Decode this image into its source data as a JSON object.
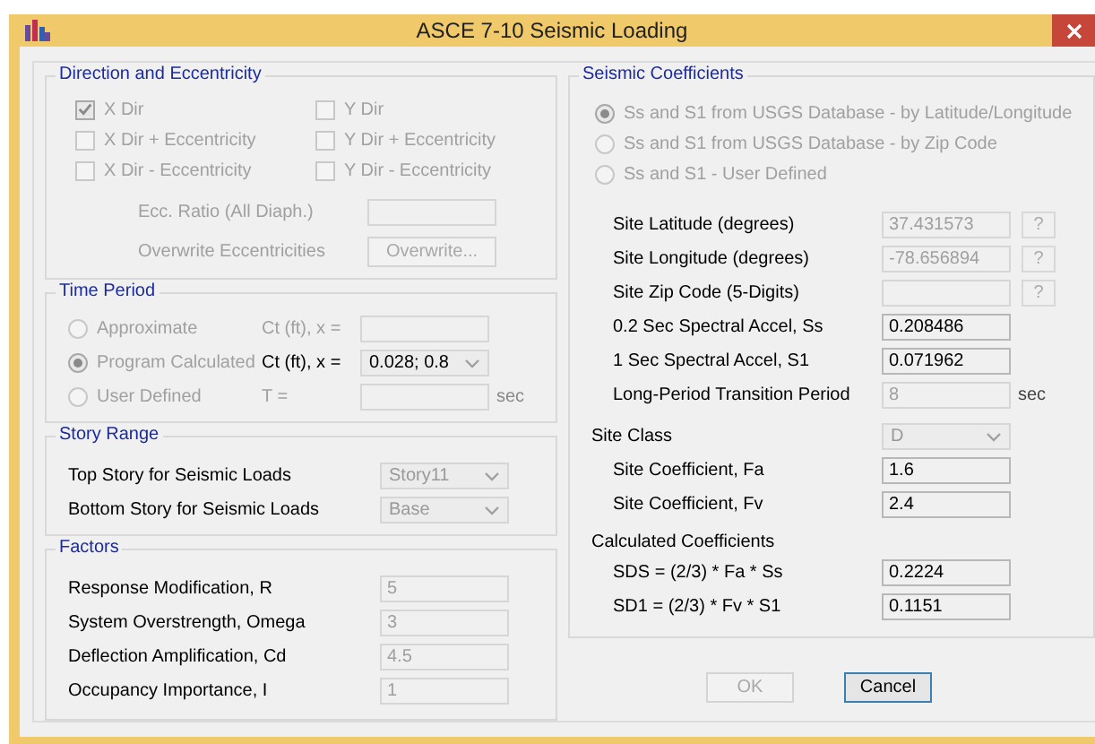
{
  "window": {
    "title": "ASCE 7-10 Seismic Loading"
  },
  "direction": {
    "title": "Direction and Eccentricity",
    "checks": [
      {
        "label": "X Dir",
        "checked": true,
        "disabled": true
      },
      {
        "label": "Y Dir",
        "checked": false,
        "disabled": true
      },
      {
        "label": "X Dir + Eccentricity",
        "checked": false,
        "disabled": true
      },
      {
        "label": "Y Dir + Eccentricity",
        "checked": false,
        "disabled": true
      },
      {
        "label": "X Dir - Eccentricity",
        "checked": false,
        "disabled": true
      },
      {
        "label": "Y Dir - Eccentricity",
        "checked": false,
        "disabled": true
      }
    ],
    "ecc_ratio": {
      "label": "Ecc. Ratio (All Diaph.)",
      "disabled": true
    },
    "overwrite": {
      "label": "Overwrite Eccentricities",
      "button": "Overwrite...",
      "disabled": true
    }
  },
  "time_period": {
    "title": "Time Period",
    "rows": [
      {
        "option": {
          "label": "Approximate",
          "selected": false,
          "disabled": true
        },
        "param": {
          "label": "Ct (ft), x =",
          "kind": "field",
          "disabled": true
        }
      },
      {
        "option": {
          "label": "Program Calculated",
          "selected": true,
          "disabled": true
        },
        "param": {
          "label": "Ct (ft), x =",
          "kind": "dropdown",
          "value": "0.028;  0.8",
          "disabled": false
        }
      },
      {
        "option": {
          "label": "User Defined",
          "selected": false,
          "disabled": true
        },
        "param": {
          "label": "T =",
          "kind": "field",
          "unit": "sec",
          "disabled": true
        }
      }
    ]
  },
  "story_range": {
    "title": "Story Range",
    "rows": [
      {
        "label": "Top Story for Seismic Loads",
        "value": "Story11"
      },
      {
        "label": "Bottom Story for Seismic Loads",
        "value": "Base"
      }
    ]
  },
  "factors": {
    "title": "Factors",
    "rows": [
      {
        "label": "Response Modification, R",
        "value": "5"
      },
      {
        "label": "System Overstrength, Omega",
        "value": "3"
      },
      {
        "label": "Deflection Amplification, Cd",
        "value": "4.5"
      },
      {
        "label": "Occupancy Importance, I",
        "value": "1"
      }
    ]
  },
  "seismic": {
    "title": "Seismic Coefficients",
    "options": [
      {
        "label": "Ss and S1 from USGS Database - by Latitude/Longitude",
        "selected": true,
        "disabled": true
      },
      {
        "label": "Ss and S1 from USGS Database - by Zip Code",
        "selected": false,
        "disabled": true
      },
      {
        "label": "Ss and S1 - User Defined",
        "selected": false,
        "disabled": true
      }
    ],
    "fields": [
      {
        "label": "Site Latitude (degrees)",
        "value": "37.431573",
        "disabled": true,
        "help": "?"
      },
      {
        "label": "Site Longitude (degrees)",
        "value": "-78.656894",
        "disabled": true,
        "help": "?"
      },
      {
        "label": "Site Zip Code (5-Digits)",
        "disabled": true,
        "help": "?"
      },
      {
        "label": "0.2 Sec Spectral Accel, Ss",
        "value": "0.208486",
        "disabled": false
      },
      {
        "label": "1 Sec Spectral Accel, S1",
        "value": "0.071962",
        "disabled": false
      },
      {
        "label": "Long-Period Transition Period",
        "value": "8",
        "disabled": true,
        "unit": "sec"
      }
    ],
    "site_class": {
      "label": "Site Class",
      "value": "D"
    },
    "site_coefficients": [
      {
        "label": "Site Coefficient, Fa",
        "value": "1.6"
      },
      {
        "label": "Site Coefficient, Fv",
        "value": "2.4"
      }
    ],
    "calculated": {
      "title": "Calculated Coefficients",
      "rows": [
        {
          "label": "SDS = (2/3) * Fa * Ss",
          "value": "0.2224"
        },
        {
          "label": "SD1 = (2/3) * Fv * S1",
          "value": "0.1151"
        }
      ]
    }
  },
  "buttons": [
    {
      "label": "OK",
      "disabled": true
    },
    {
      "label": "Cancel",
      "disabled": false
    }
  ]
}
